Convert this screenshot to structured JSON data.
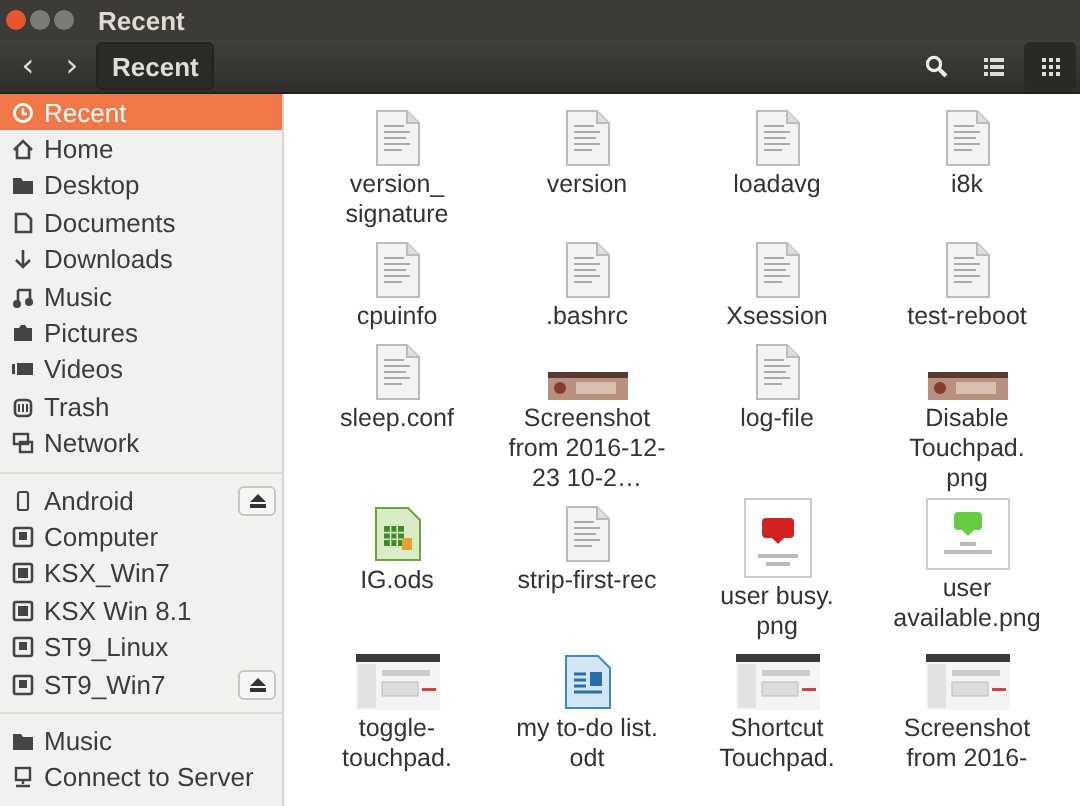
{
  "window": {
    "title": "Recent"
  },
  "toolbar": {
    "back": "‹",
    "forward": "›",
    "path": [
      {
        "label": "Recent",
        "selected": true
      }
    ]
  },
  "sidebar": {
    "groups": [
      [
        {
          "label": "Recent",
          "kind": "recent",
          "selected": true
        },
        {
          "label": "Home",
          "kind": "home",
          "selected": false
        },
        {
          "label": "Desktop",
          "kind": "folder",
          "selected": false
        },
        {
          "label": "Documents",
          "kind": "document",
          "selected": false
        },
        {
          "label": "Downloads",
          "kind": "download",
          "selected": false
        },
        {
          "label": "Music",
          "kind": "music",
          "selected": false
        },
        {
          "label": "Pictures",
          "kind": "camera",
          "selected": false
        },
        {
          "label": "Videos",
          "kind": "video",
          "selected": false
        },
        {
          "label": "Trash",
          "kind": "trash",
          "selected": false
        },
        {
          "label": "Network",
          "kind": "network",
          "selected": false
        }
      ],
      [
        {
          "label": "Android",
          "kind": "phone",
          "selected": false,
          "ejectable": true
        },
        {
          "label": "Computer",
          "kind": "drive",
          "selected": false,
          "ejectable": false
        },
        {
          "label": "KSX_Win7",
          "kind": "disk",
          "selected": false,
          "ejectable": false
        },
        {
          "label": "KSX Win 8.1",
          "kind": "disk",
          "selected": false,
          "ejectable": false
        },
        {
          "label": "ST9_Linux",
          "kind": "drive",
          "selected": false,
          "ejectable": false
        },
        {
          "label": "ST9_Win7",
          "kind": "drive",
          "selected": false,
          "ejectable": true
        }
      ],
      [
        {
          "label": "Music",
          "kind": "folder",
          "selected": false
        },
        {
          "label": "Connect to Server",
          "kind": "server",
          "selected": false
        }
      ]
    ]
  },
  "files": [
    {
      "name": "version_ signature",
      "kind": "text"
    },
    {
      "name": "version",
      "kind": "text"
    },
    {
      "name": "loadavg",
      "kind": "text"
    },
    {
      "name": "i8k",
      "kind": "text"
    },
    {
      "name": "cpuinfo",
      "kind": "text"
    },
    {
      "name": ".bashrc",
      "kind": "text"
    },
    {
      "name": "Xsession",
      "kind": "text"
    },
    {
      "name": "test-reboot",
      "kind": "text"
    },
    {
      "name": "sleep.conf",
      "kind": "text"
    },
    {
      "name": "Screenshot from 2016-12-23 10-2…",
      "kind": "picture"
    },
    {
      "name": "log-file",
      "kind": "text"
    },
    {
      "name": "Disable Touchpad. png",
      "kind": "picture"
    },
    {
      "name": "IG.ods",
      "kind": "spreadsheet"
    },
    {
      "name": "strip-first-rec",
      "kind": "text"
    },
    {
      "name": "user busy. png",
      "kind": "busy"
    },
    {
      "name": "user available.png",
      "kind": "available"
    },
    {
      "name": "toggle- touchpad.",
      "kind": "screenshot"
    },
    {
      "name": "my to-do list. odt",
      "kind": "writer"
    },
    {
      "name": "Shortcut Touchpad.",
      "kind": "screenshot"
    },
    {
      "name": "Screenshot from 2016-",
      "kind": "screenshot"
    }
  ]
}
